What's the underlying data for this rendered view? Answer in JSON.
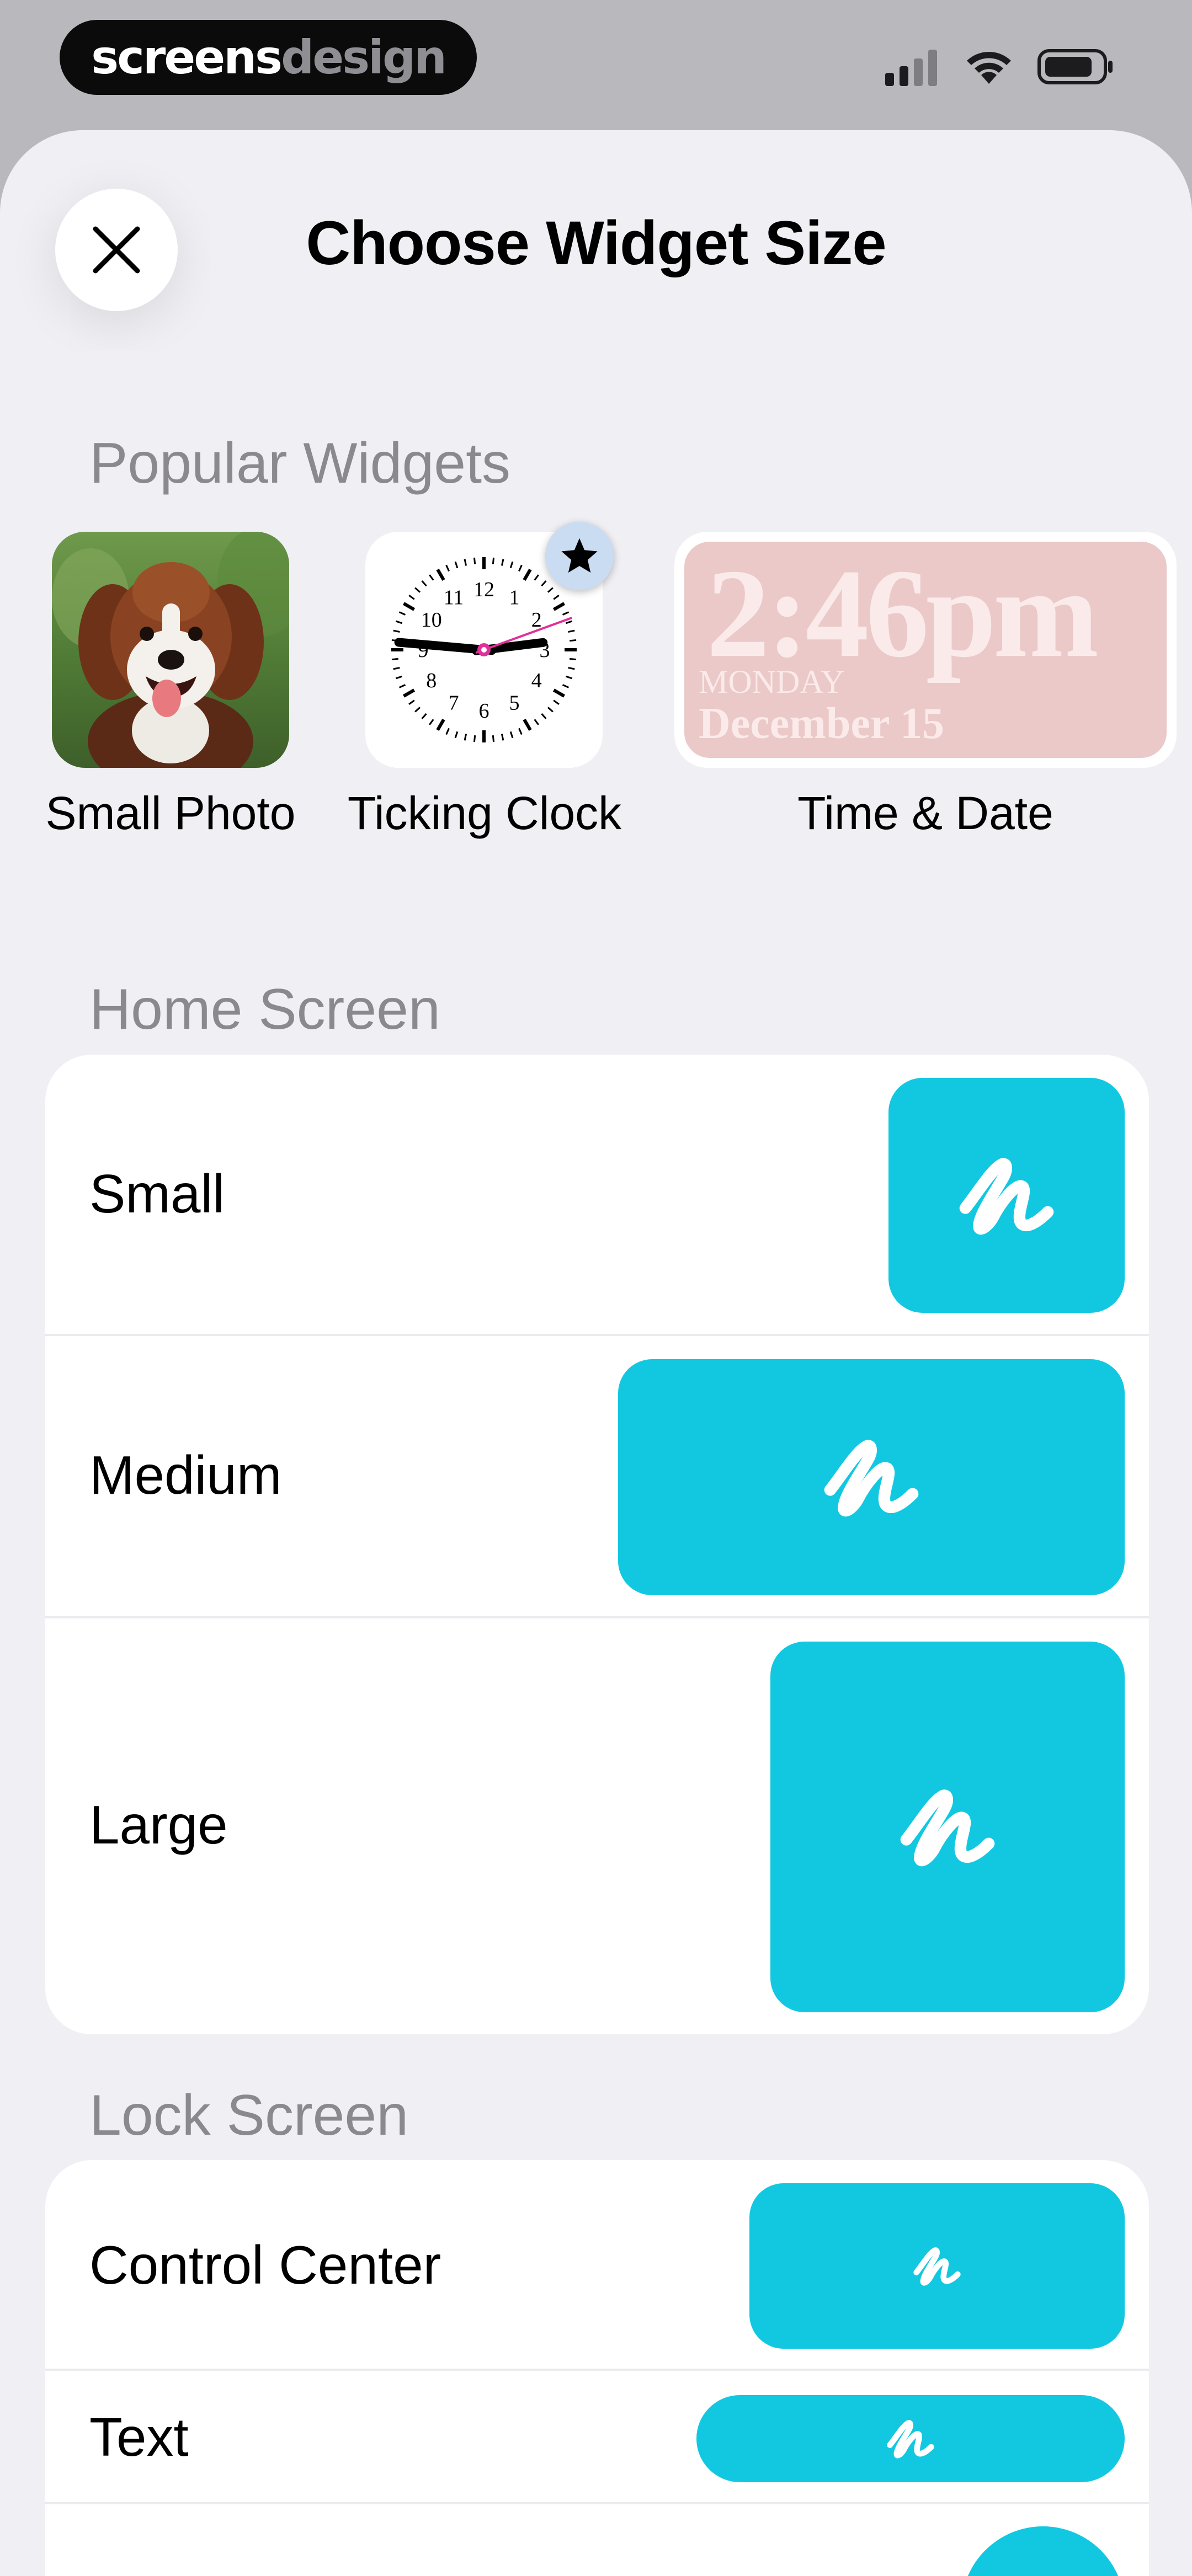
{
  "status_bar": {
    "brand_part1": "screens",
    "brand_part2": "design",
    "signal_icon": "cellular-signal-icon",
    "wifi_icon": "wifi-icon",
    "battery_icon": "battery-icon"
  },
  "sheet": {
    "title": "Choose Widget Size",
    "close_icon": "close-icon"
  },
  "popular": {
    "header": "Popular Widgets",
    "items": [
      {
        "label": "Small Photo",
        "image": "dog-photo"
      },
      {
        "label": "Ticking Clock",
        "image": "analog-clock",
        "badge": "star-icon"
      },
      {
        "label": "Time & Date",
        "time": "2:46pm",
        "day": "MONDAY",
        "date": "December 15"
      }
    ]
  },
  "home_screen": {
    "header": "Home Screen",
    "rows": [
      {
        "label": "Small"
      },
      {
        "label": "Medium"
      },
      {
        "label": "Large"
      }
    ]
  },
  "lock_screen": {
    "header": "Lock Screen",
    "rows": [
      {
        "label": "Control Center"
      },
      {
        "label": "Text"
      }
    ]
  },
  "colors": {
    "accent": "#12c8e1",
    "sheet_background": "#efeff4",
    "secondary_text": "#8a8a8e",
    "timedate_background": "#eac9c8"
  },
  "clock": {
    "numbers": [
      "12",
      "1",
      "2",
      "3",
      "4",
      "5",
      "6",
      "7",
      "8",
      "9",
      "10",
      "11"
    ]
  }
}
